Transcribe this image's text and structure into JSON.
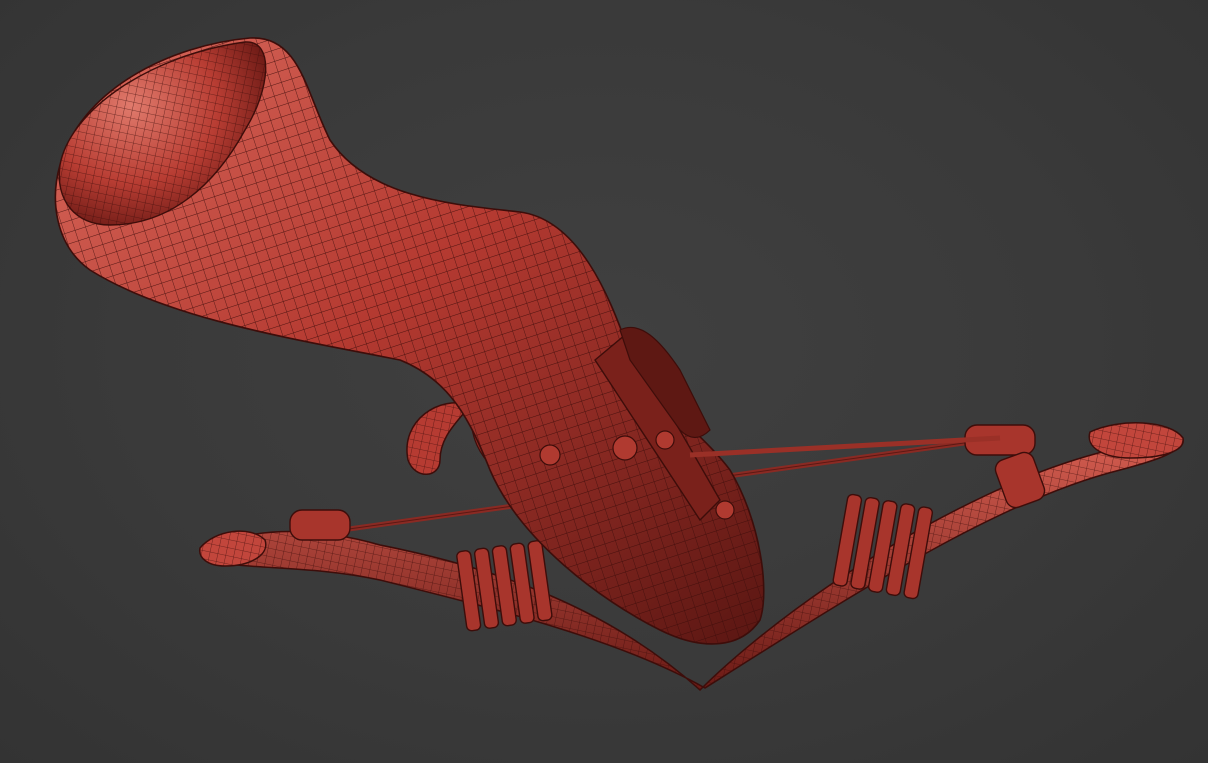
{
  "scene": {
    "background_color": "#3a3a3a",
    "model_color": "#c2463c",
    "model_shadow_color": "#5a1612",
    "wire_color": "#3d0d0a",
    "subject": "crossbow-wireframe-model"
  }
}
